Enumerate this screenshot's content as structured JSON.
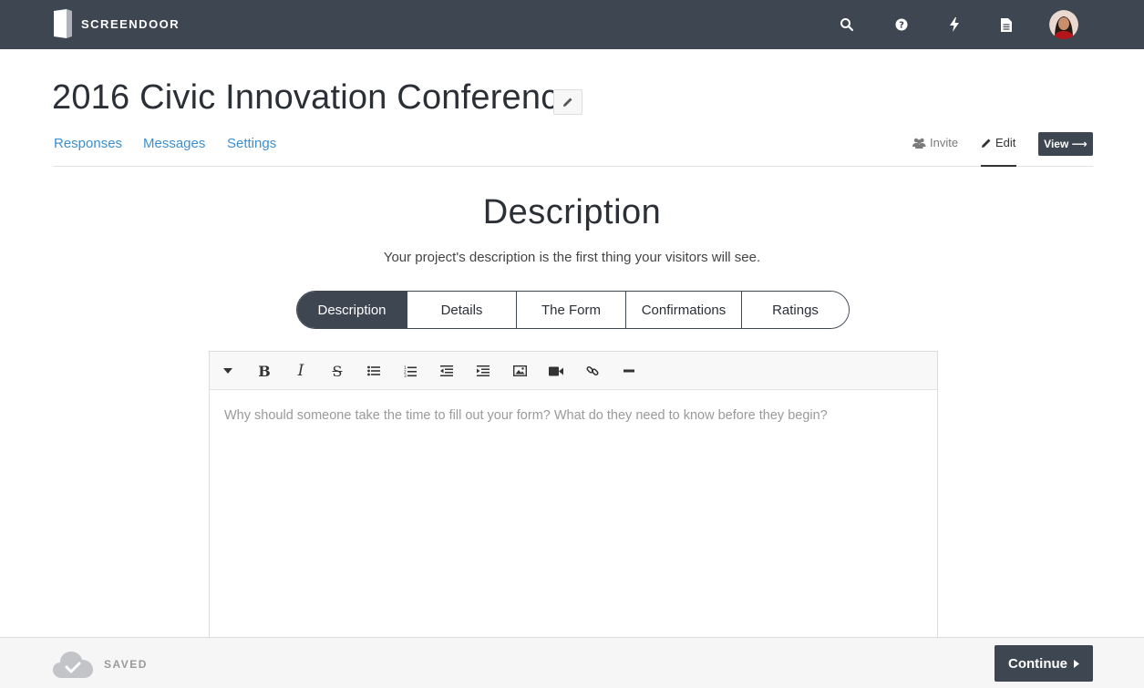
{
  "app": {
    "brand": "SCREENDOOR",
    "nav_icons": [
      "search-icon",
      "help-icon",
      "lightning-icon",
      "document-icon"
    ],
    "accent_color": "#3e4651",
    "link_color": "#3a8fd0"
  },
  "project": {
    "title": "2016 Civic Innovation Conference"
  },
  "subnav": {
    "links": [
      "Responses",
      "Messages",
      "Settings"
    ],
    "invite_label": "Invite",
    "edit_label": "Edit",
    "view_label": "View ⟶"
  },
  "section": {
    "title": "Description",
    "subtitle": "Your project's description is the first thing your visitors will see."
  },
  "tabs": {
    "items": [
      "Description",
      "Details",
      "The Form",
      "Confirmations",
      "Ratings"
    ],
    "active": "Description"
  },
  "editor": {
    "toolbar_icons": [
      "dropdown-caret-icon",
      "bold-icon",
      "italic-icon",
      "strikethrough-icon",
      "bullet-list-icon",
      "numbered-list-icon",
      "outdent-icon",
      "indent-icon",
      "image-icon",
      "video-icon",
      "link-icon",
      "horizontal-rule-icon"
    ],
    "placeholder": "Why should someone take the time to fill out your form? What do they need to know before they begin?"
  },
  "footer": {
    "status": "SAVED",
    "continue_label": "Continue"
  }
}
